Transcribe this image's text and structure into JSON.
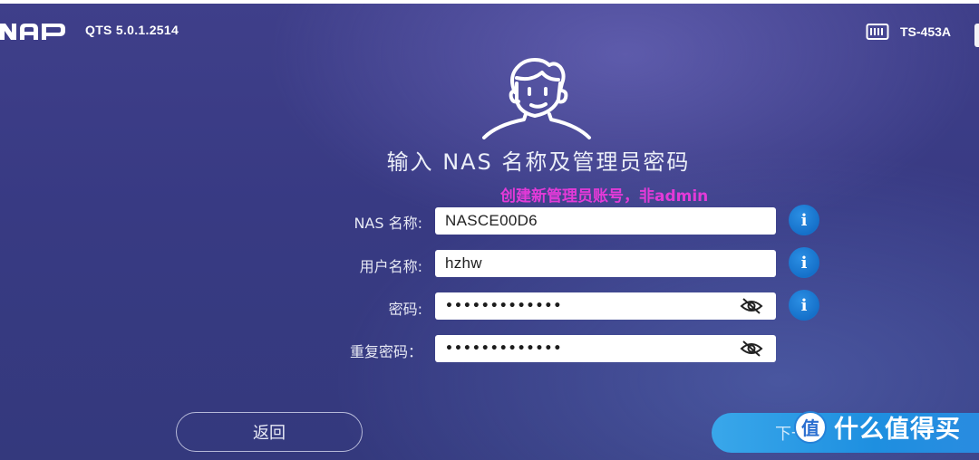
{
  "header": {
    "logo_text": "NAP",
    "version": "QTS 5.0.1.2514",
    "model": "TS-453A",
    "model_icon": "nas-device-icon"
  },
  "page": {
    "title": "输入 NAS 名称及管理员密码",
    "annotation": "创建新管理员账号，非admin",
    "avatar_icon": "user-avatar-icon"
  },
  "form": {
    "nas_name": {
      "label": "NAS 名称:",
      "value": "NASCE00D6"
    },
    "username": {
      "label": "用户名称:",
      "value": "hzhw"
    },
    "password": {
      "label": "密码:",
      "value": "•••••••••••••",
      "toggle_icon": "eye-hidden-icon"
    },
    "confirm_password": {
      "label": "重复密码：",
      "value": "•••••••••••••",
      "toggle_icon": "eye-hidden-icon"
    },
    "info_icon_glyph": "i"
  },
  "buttons": {
    "back": "返回",
    "next": "下一步"
  },
  "watermark": {
    "badge": "值",
    "text": "什么值得买"
  },
  "colors": {
    "background": "#3a3c85",
    "info_blue": "#1f80d8",
    "next_blue": "#2496e4",
    "annotation_magenta": "#e33ad8"
  }
}
